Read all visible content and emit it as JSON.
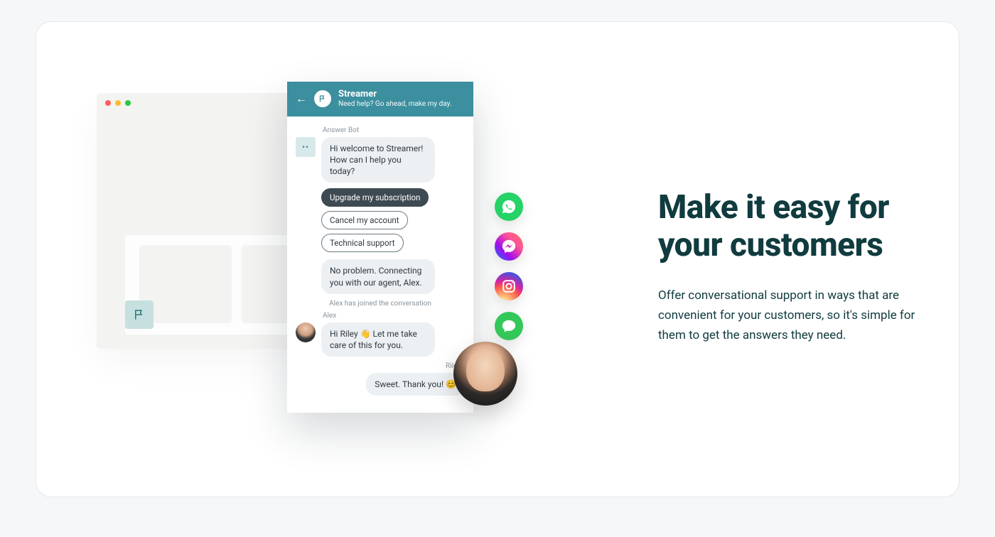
{
  "headline": "Make it easy for your customers",
  "subtext": "Offer conversational support in ways that are convenient for your customers, so it's simple for them to get the answers they need.",
  "chat": {
    "header": {
      "title": "Streamer",
      "subtitle": "Need help? Go ahead, make my day."
    },
    "bot_name": "Answer Bot",
    "bot_greeting": "Hi welcome to Streamer! How can I help you today?",
    "options": {
      "upgrade": "Upgrade my subscription",
      "cancel": "Cancel my account",
      "support": "Technical support"
    },
    "connecting_msg": "No problem. Connecting you with our agent, Alex.",
    "join_msg": "Alex has joined the conversation",
    "agent_name": "Alex",
    "agent_msg": "Hi Riley 👋 Let me take care of this for you.",
    "user_name": "Riley",
    "user_msg": "Sweet. Thank you! 😊"
  },
  "socials": {
    "whatsapp": "whatsapp-icon",
    "messenger": "messenger-icon",
    "instagram": "instagram-icon",
    "imessage": "imessage-icon"
  }
}
